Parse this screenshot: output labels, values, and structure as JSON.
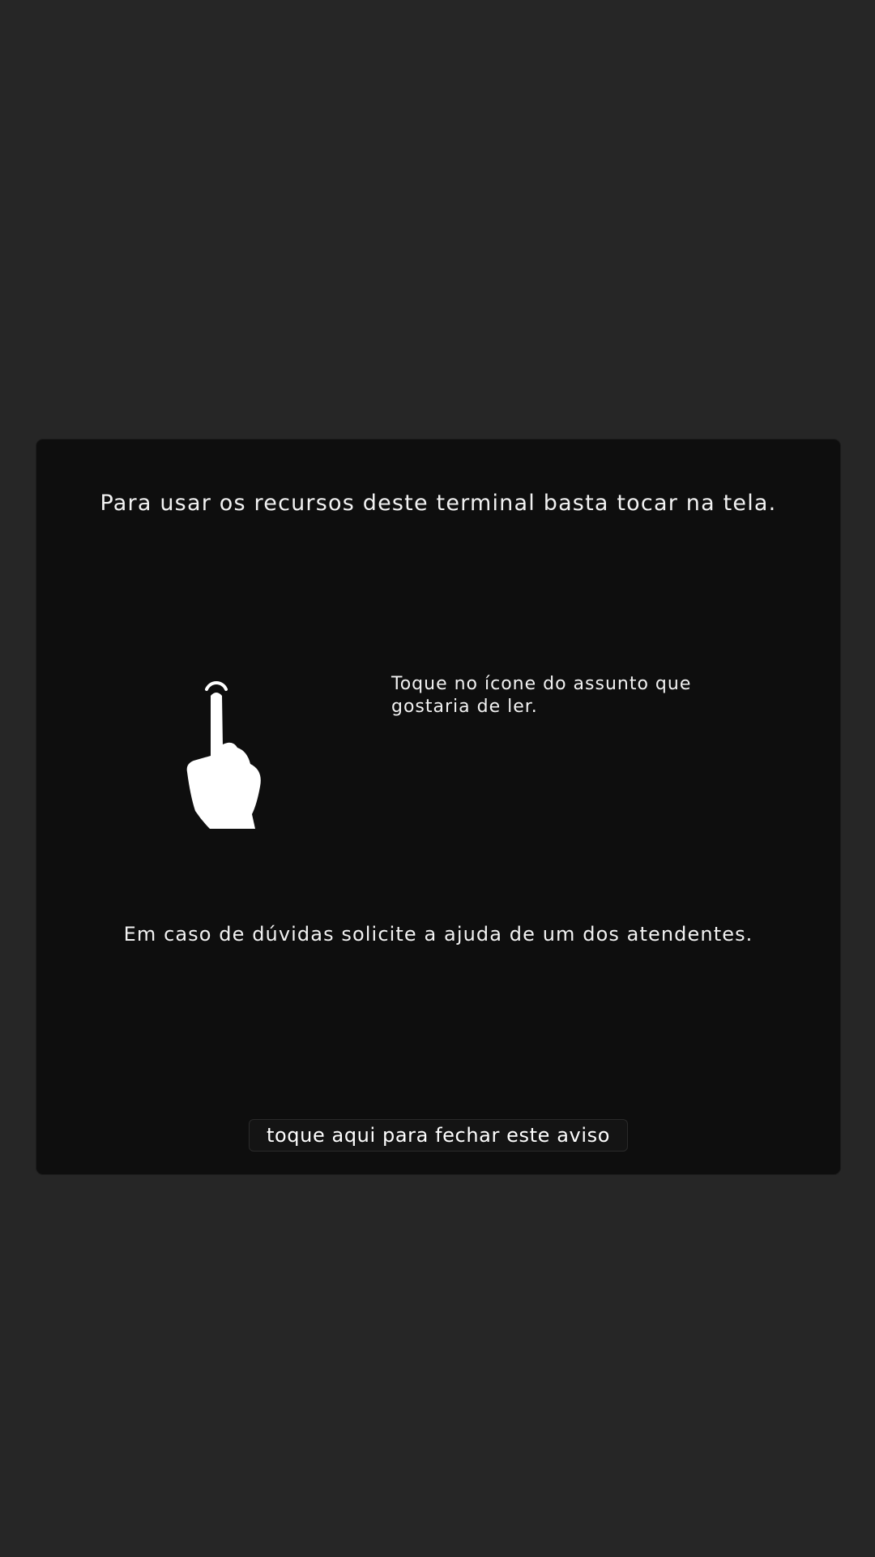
{
  "dialog": {
    "title": "Para usar os recursos deste terminal basta tocar na tela.",
    "instruction": "Toque no ícone do assunto que gostaria de ler.",
    "help_text": "Em caso de dúvidas solicite a ajuda de um dos atendentes.",
    "close_label": "toque aqui para fechar este aviso",
    "icon": "tap-hand-icon"
  },
  "colors": {
    "background": "#262626",
    "dialog_background": "#0e0e0e",
    "text": "#ffffff"
  }
}
